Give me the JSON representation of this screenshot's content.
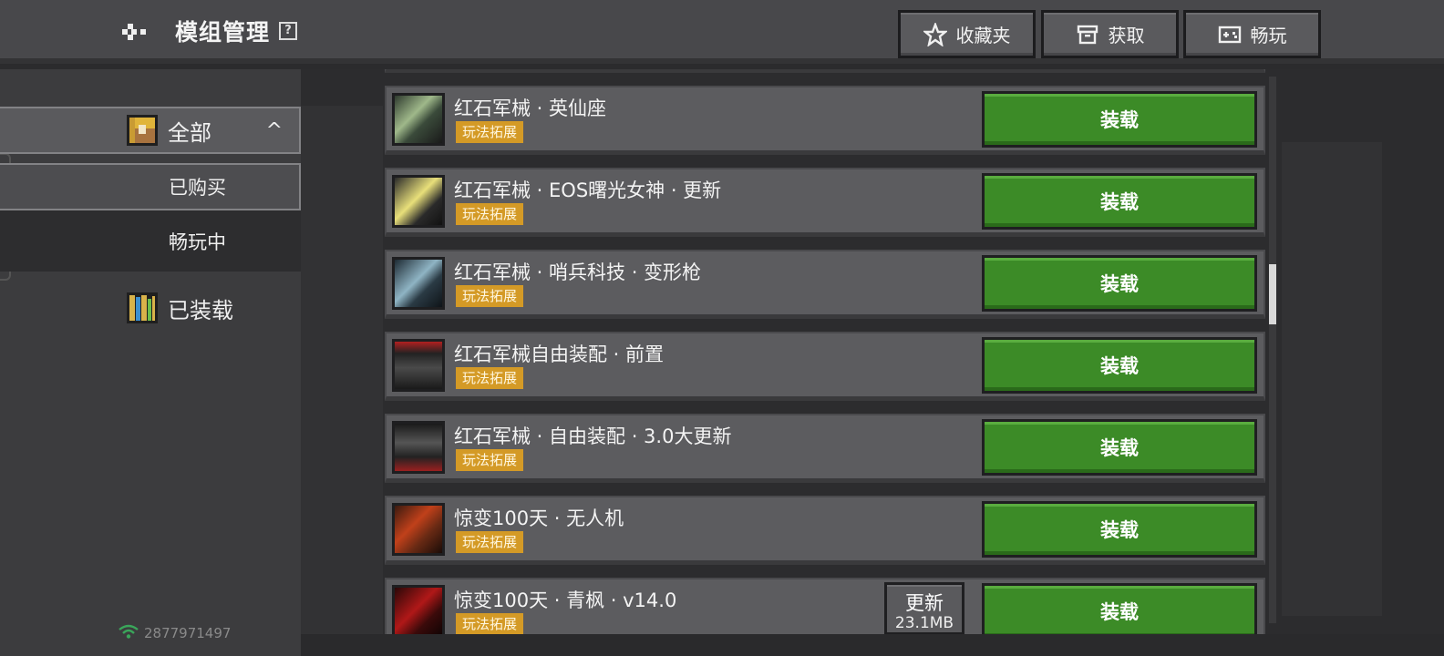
{
  "header": {
    "title": "模组管理",
    "help_symbol": "?",
    "favorites_label": "收藏夹",
    "get_label": "获取",
    "play_label": "畅玩"
  },
  "sidebar": {
    "all_label": "全部",
    "bought_label": "已购买",
    "playing_label": "畅玩中",
    "loaded_label": "已装载",
    "collapse_glyph": "^",
    "user_id": "2877971497"
  },
  "list": {
    "items": [
      {
        "title": "红石军械 · 英仙座",
        "tag": "玩法拓展",
        "load_label": "装载"
      },
      {
        "title": "红石军械 · EOS曙光女神 · 更新",
        "tag": "玩法拓展",
        "load_label": "装载"
      },
      {
        "title": "红石军械 · 哨兵科技 · 变形枪",
        "tag": "玩法拓展",
        "load_label": "装载"
      },
      {
        "title": "红石军械自由装配 · 前置",
        "tag": "玩法拓展",
        "load_label": "装载"
      },
      {
        "title": "红石军械 · 自由装配 · 3.0大更新",
        "tag": "玩法拓展",
        "load_label": "装载"
      },
      {
        "title": "惊变100天 · 无人机",
        "tag": "玩法拓展",
        "load_label": "装载"
      },
      {
        "title": "惊变100天 · 青枫 · v14.0",
        "tag": "玩法拓展",
        "load_label": "装载",
        "update_label": "更新",
        "update_size": "23.1MB"
      }
    ]
  },
  "colors": {
    "load_green": "#3c8b27",
    "tag_orange": "#d49a26",
    "header_bg": "#48484b",
    "sidebar_bg": "#3c3c3e"
  },
  "icons": {
    "back": "back-arrow-icon",
    "favorites": "star-icon",
    "get": "store-icon",
    "play": "gamepad-icon",
    "all": "chest-icon",
    "loaded": "bookshelf-icon",
    "wifi": "wifi-icon"
  }
}
